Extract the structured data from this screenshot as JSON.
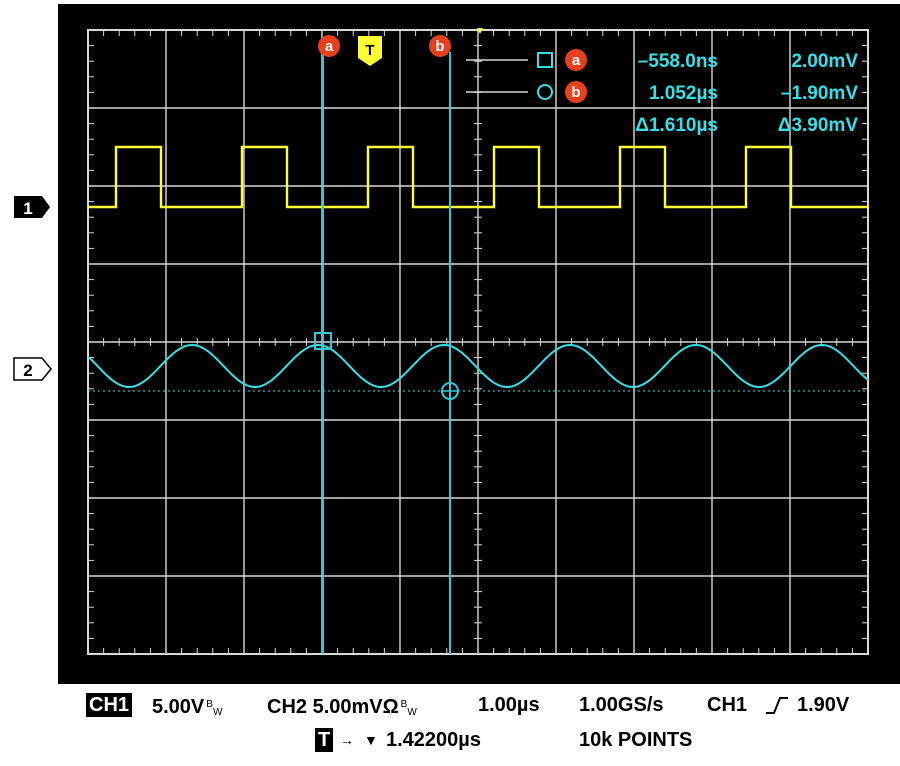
{
  "chart_data": {
    "type": "line",
    "title": "",
    "xlabel": "",
    "ylabel": "",
    "grid": true,
    "x_divisions": 10,
    "y_divisions": 8,
    "series": [
      {
        "name": "CH1",
        "color": "#ffff33",
        "shape": "square",
        "period_us": 1.0,
        "duty": 0.37,
        "low_div": -0.0,
        "high_div": 0.92,
        "marker": "1"
      },
      {
        "name": "CH2",
        "color": "#33e0e8",
        "shape": "sine",
        "period_us": 1.0,
        "amp_div": 0.3,
        "center_div": 0.0,
        "marker": "2"
      }
    ],
    "cursors": {
      "a": {
        "label": "a",
        "time": "–558.0ns",
        "value": "2.00mV"
      },
      "b": {
        "label": "b",
        "time": "1.052µs",
        "value": "–1.90mV"
      },
      "delta_time": "Δ1.610µs",
      "delta_value": "Δ3.90mV"
    },
    "trigger_marker": "T",
    "channel_markers": [
      "1",
      "2"
    ]
  },
  "status": {
    "ch1_box": "CH1",
    "ch1_scale": "5.00V",
    "ch1_bw": "BW",
    "ch2_label": "CH2 5.00mVΩ",
    "ch2_bw": "BW",
    "timebase": "1.00µs",
    "sample_rate": "1.00GS/s",
    "trigger_source": "CH1",
    "trigger_level": "1.90V",
    "trigger_box": "T",
    "trigger_pos": "1.42200µs",
    "record_length": "10k POINTS"
  },
  "colors": {
    "ch1": "#ffff33",
    "ch2": "#33e0e8",
    "cursor": "#33c8d8",
    "cursor_badge": "#e8401c",
    "grid": "#d8d8d8",
    "screen": "#000000"
  }
}
